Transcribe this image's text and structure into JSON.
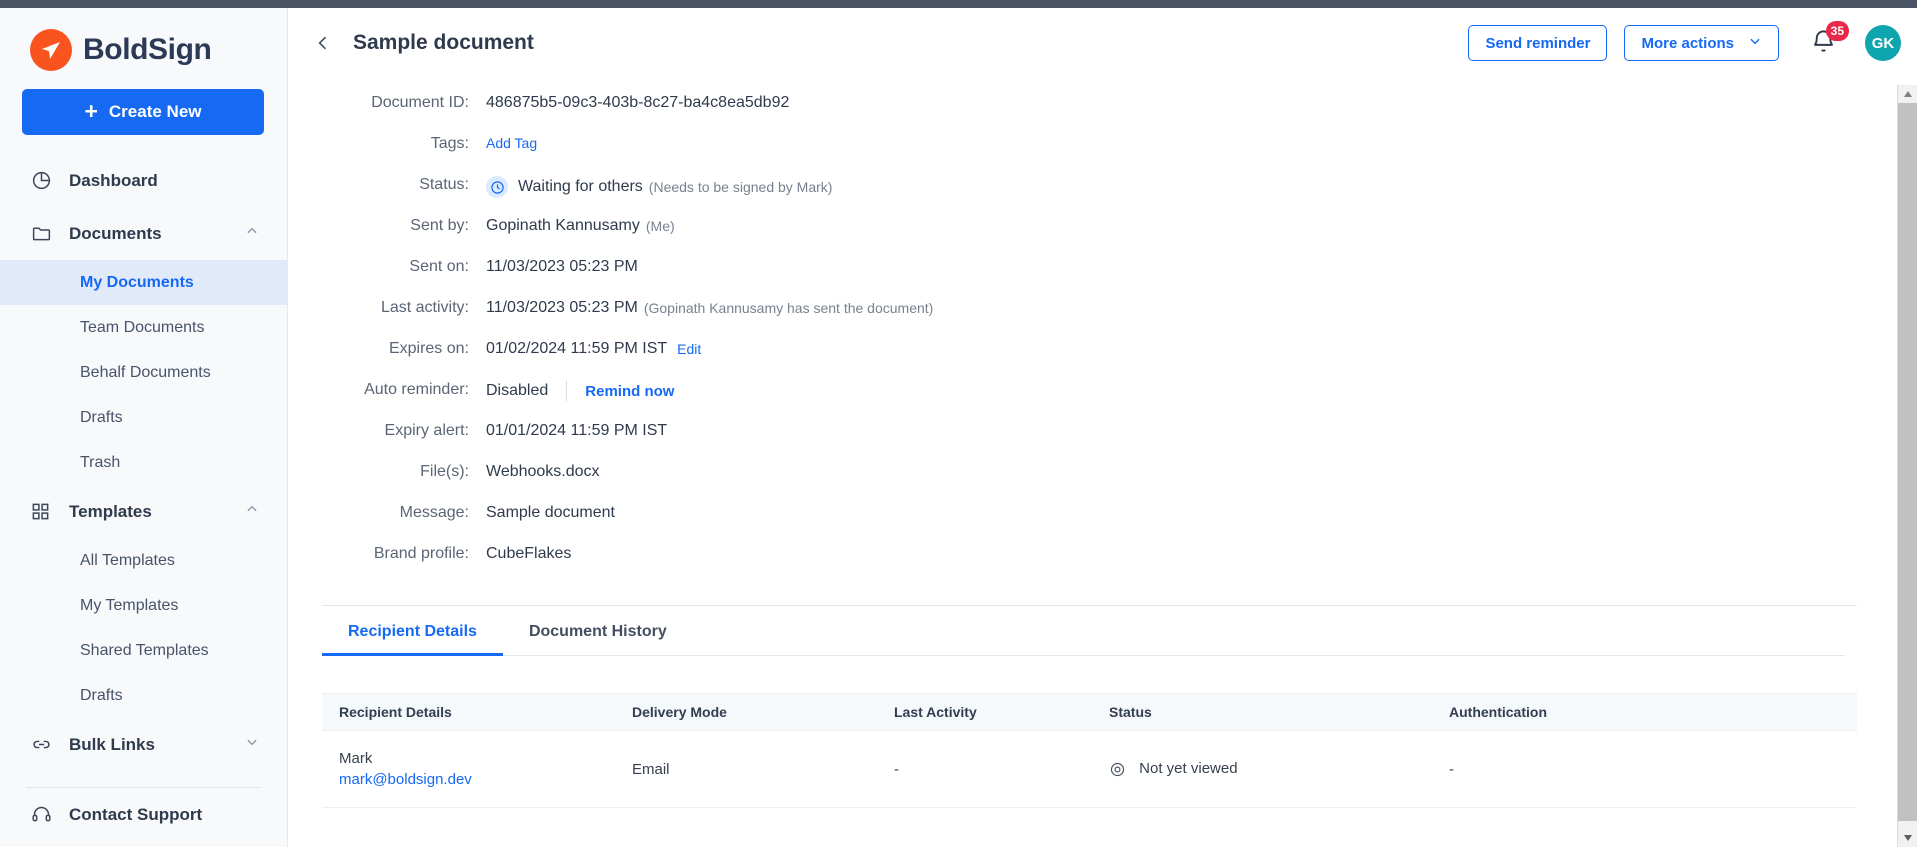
{
  "brand": {
    "name": "BoldSign",
    "logo_icon": "boldsign-paper-plane-icon",
    "accent": "#f9541d"
  },
  "sidebar": {
    "create_button": {
      "label": "Create New",
      "icon": "plus-icon",
      "color": "#1569f2"
    },
    "items": [
      {
        "label": "Dashboard",
        "icon": "pie-chart-icon",
        "type": "group",
        "collapsible": false
      },
      {
        "label": "Documents",
        "icon": "folder-icon",
        "type": "group",
        "collapsible": true,
        "chevron": "chevron-up-icon"
      },
      {
        "label": "My Documents",
        "type": "child",
        "active": true
      },
      {
        "label": "Team Documents",
        "type": "child",
        "active": false
      },
      {
        "label": "Behalf Documents",
        "type": "child",
        "active": false
      },
      {
        "label": "Drafts",
        "type": "child",
        "active": false
      },
      {
        "label": "Trash",
        "type": "child",
        "active": false
      },
      {
        "label": "Templates",
        "icon": "grid-icon",
        "type": "group",
        "collapsible": true,
        "chevron": "chevron-up-icon"
      },
      {
        "label": "All Templates",
        "type": "child",
        "active": false
      },
      {
        "label": "My Templates",
        "type": "child",
        "active": false
      },
      {
        "label": "Shared Templates",
        "type": "child",
        "active": false
      },
      {
        "label": "Drafts",
        "type": "child",
        "active": false
      },
      {
        "label": "Bulk Links",
        "icon": "link-icon",
        "type": "group",
        "collapsible": true,
        "chevron": "chevron-down-icon"
      },
      {
        "label": "Contact Support",
        "icon": "headset-icon",
        "type": "group",
        "collapsible": false
      }
    ]
  },
  "header": {
    "back_icon": "chevron-left-icon",
    "title": "Sample document",
    "send_reminder_label": "Send reminder",
    "more_actions_label": "More actions",
    "more_actions_icon": "chevron-down-icon",
    "bell_icon": "bell-icon",
    "notification_count": "35",
    "notification_color": "#e8294a",
    "avatar_initials": "GK",
    "avatar_color": "#0fa5ae"
  },
  "details": [
    {
      "label": "Document ID:",
      "value": "486875b5-09c3-403b-8c27-ba4c8ea5db92"
    },
    {
      "label": "Tags:",
      "link": "Add Tag"
    },
    {
      "label": "Status:",
      "icon": "clock-icon",
      "value": "Waiting for others",
      "sub": "(Needs to be signed by Mark)"
    },
    {
      "label": "Sent by:",
      "value": "Gopinath Kannusamy",
      "sub": "(Me)"
    },
    {
      "label": "Sent on:",
      "value": "11/03/2023 05:23 PM"
    },
    {
      "label": "Last activity:",
      "value": "11/03/2023 05:23 PM",
      "sub": "(Gopinath Kannusamy has sent the document)"
    },
    {
      "label": "Expires on:",
      "value": "01/02/2024 11:59 PM IST",
      "link": "Edit"
    },
    {
      "label": "Auto reminder:",
      "value": "Disabled",
      "divider": true,
      "link": "Remind now"
    },
    {
      "label": "Expiry alert:",
      "value": "01/01/2024 11:59 PM IST"
    },
    {
      "label": "File(s):",
      "value": "Webhooks.docx"
    },
    {
      "label": "Message:",
      "value": "Sample document"
    },
    {
      "label": "Brand profile:",
      "value": "CubeFlakes"
    }
  ],
  "tabs": [
    {
      "label": "Recipient Details",
      "active": true
    },
    {
      "label": "Document History",
      "active": false
    }
  ],
  "table": {
    "columns": [
      "Recipient Details",
      "Delivery Mode",
      "Last Activity",
      "Status",
      "Authentication"
    ],
    "rows": [
      {
        "name": "Mark",
        "email": "mark@boldsign.dev",
        "delivery_mode": "Email",
        "last_activity": "-",
        "status": "Not yet viewed",
        "status_icon": "eye-icon",
        "authentication": "-"
      }
    ]
  },
  "scrollbar": {
    "up_icon": "triangle-up-icon",
    "down_icon": "triangle-down-icon"
  }
}
